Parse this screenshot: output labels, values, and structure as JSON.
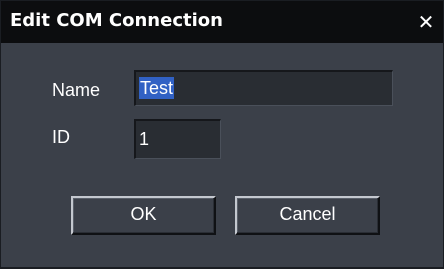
{
  "window": {
    "title": "Edit COM Connection",
    "close_glyph": "✕"
  },
  "form": {
    "name_label": "Name",
    "name_value": "Test",
    "id_label": "ID",
    "id_value": "1"
  },
  "buttons": {
    "ok_label": "OK",
    "cancel_label": "Cancel"
  },
  "colors": {
    "titlebar": "#0c0d0f",
    "dialog_bg": "#3b4049",
    "input_bg": "#292d33",
    "selection": "#3161c4",
    "text": "#ffffff"
  }
}
